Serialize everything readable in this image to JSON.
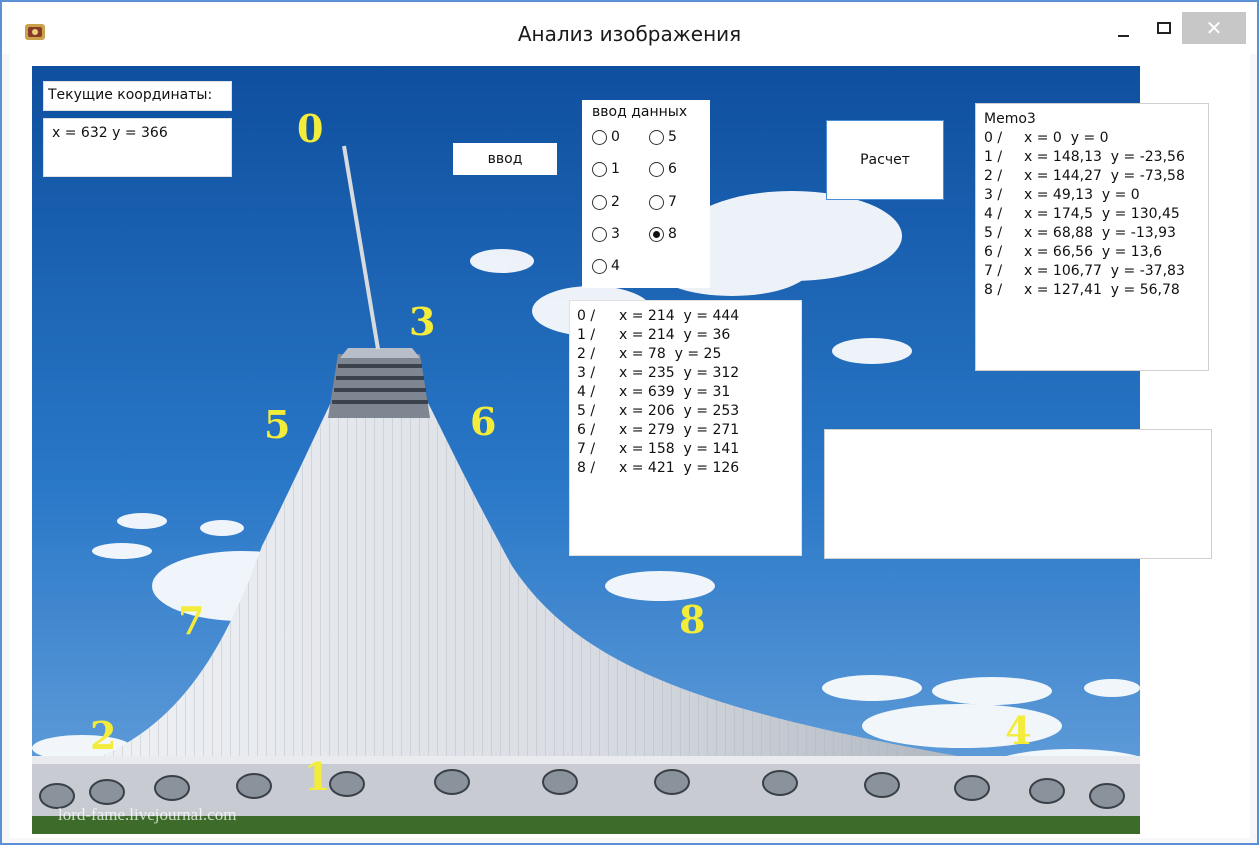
{
  "window": {
    "title": "Анализ изображения",
    "close_glyph": "✕"
  },
  "labels": {
    "current_coords_title": "Текущие координаты:",
    "current_coords_value": "x = 632  y = 366"
  },
  "buttons": {
    "input": "ввод",
    "calculate": "Расчет"
  },
  "radio_group": {
    "title": "ввод данных",
    "options": [
      "0",
      "1",
      "2",
      "3",
      "4",
      "5",
      "6",
      "7",
      "8"
    ],
    "selected": "8"
  },
  "input_memo": [
    {
      "idx": "0 /",
      "text": "x = 214  y = 444"
    },
    {
      "idx": "1 /",
      "text": "x = 214  y = 36"
    },
    {
      "idx": "2 /",
      "text": "x = 78  y = 25"
    },
    {
      "idx": "3 /",
      "text": "x = 235  y = 312"
    },
    {
      "idx": "4 /",
      "text": "x = 639  y = 31"
    },
    {
      "idx": "5 /",
      "text": "x = 206  y = 253"
    },
    {
      "idx": "6 /",
      "text": "x = 279  y = 271"
    },
    {
      "idx": "7 /",
      "text": "x = 158  y = 141"
    },
    {
      "idx": "8 /",
      "text": "x = 421  y = 126"
    }
  ],
  "memo3": {
    "title": "Memo3",
    "rows": [
      {
        "idx": "0 /",
        "text": "x = 0  y = 0"
      },
      {
        "idx": "1 /",
        "text": "x = 148,13  y = -23,56"
      },
      {
        "idx": "2 /",
        "text": "x = 144,27  y = -73,58"
      },
      {
        "idx": "3 /",
        "text": "x = 49,13  y = 0"
      },
      {
        "idx": "4 /",
        "text": "x = 174,5  y = 130,45"
      },
      {
        "idx": "5 /",
        "text": "x = 68,88  y = -13,93"
      },
      {
        "idx": "6 /",
        "text": "x = 66,56  y = 13,6"
      },
      {
        "idx": "7 /",
        "text": "x = 106,77  y = -37,83"
      },
      {
        "idx": "8 /",
        "text": "x = 127,41  y = 56,78"
      }
    ]
  },
  "image": {
    "point_labels": [
      "0",
      "1",
      "2",
      "3",
      "4",
      "5",
      "6",
      "7",
      "8"
    ],
    "watermark": "lord-fame.livejournal.com",
    "label_color": "#f4ec3a",
    "sky_color": "#1f6fc4"
  }
}
